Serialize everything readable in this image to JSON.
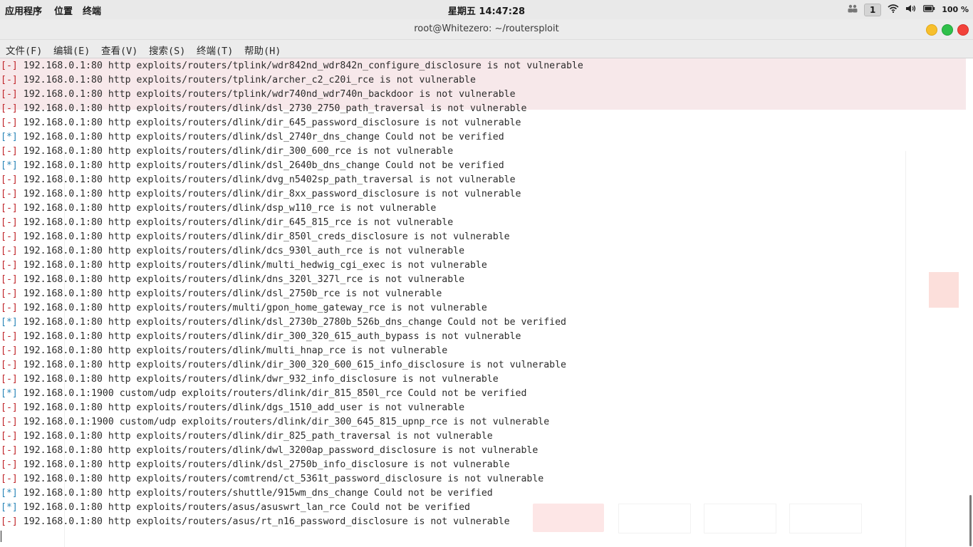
{
  "topbar": {
    "menus": [
      "应用程序",
      "位置",
      "终端"
    ],
    "clock": "星期五 14:47:28",
    "workspace": "1",
    "battery_percent": "100 %",
    "icons": [
      "people-icon",
      "wifi-icon",
      "volume-icon",
      "battery-icon"
    ]
  },
  "window": {
    "title": "root@Whitezero: ~/routersploit",
    "controls": [
      "minimize",
      "maximize",
      "close"
    ],
    "control_colors": {
      "minimize": "#f7bf2c",
      "maximize": "#2fc04a",
      "close": "#f2423a"
    }
  },
  "menubar": [
    "文件(F)",
    "编辑(E)",
    "查看(V)",
    "搜索(S)",
    "终端(T)",
    "帮助(H)"
  ],
  "colors": {
    "minus_prefix": "#c0262b",
    "star_prefix": "#2a86b8",
    "text": "#2b2b2b"
  },
  "terminal_lines": [
    {
      "prefix": "[-]",
      "text": " 192.168.0.1:80 http exploits/routers/tplink/wdr842nd_wdr842n_configure_disclosure is not vulnerable"
    },
    {
      "prefix": "[-]",
      "text": " 192.168.0.1:80 http exploits/routers/tplink/archer_c2_c20i_rce is not vulnerable"
    },
    {
      "prefix": "[-]",
      "text": " 192.168.0.1:80 http exploits/routers/tplink/wdr740nd_wdr740n_backdoor is not vulnerable"
    },
    {
      "prefix": "[-]",
      "text": " 192.168.0.1:80 http exploits/routers/dlink/dsl_2730_2750_path_traversal is not vulnerable"
    },
    {
      "prefix": "[-]",
      "text": " 192.168.0.1:80 http exploits/routers/dlink/dir_645_password_disclosure is not vulnerable"
    },
    {
      "prefix": "[*]",
      "text": " 192.168.0.1:80 http exploits/routers/dlink/dsl_2740r_dns_change Could not be verified"
    },
    {
      "prefix": "[-]",
      "text": " 192.168.0.1:80 http exploits/routers/dlink/dir_300_600_rce is not vulnerable"
    },
    {
      "prefix": "[*]",
      "text": " 192.168.0.1:80 http exploits/routers/dlink/dsl_2640b_dns_change Could not be verified"
    },
    {
      "prefix": "[-]",
      "text": " 192.168.0.1:80 http exploits/routers/dlink/dvg_n5402sp_path_traversal is not vulnerable"
    },
    {
      "prefix": "[-]",
      "text": " 192.168.0.1:80 http exploits/routers/dlink/dir_8xx_password_disclosure is not vulnerable"
    },
    {
      "prefix": "[-]",
      "text": " 192.168.0.1:80 http exploits/routers/dlink/dsp_w110_rce is not vulnerable"
    },
    {
      "prefix": "[-]",
      "text": " 192.168.0.1:80 http exploits/routers/dlink/dir_645_815_rce is not vulnerable"
    },
    {
      "prefix": "[-]",
      "text": " 192.168.0.1:80 http exploits/routers/dlink/dir_850l_creds_disclosure is not vulnerable"
    },
    {
      "prefix": "[-]",
      "text": " 192.168.0.1:80 http exploits/routers/dlink/dcs_930l_auth_rce is not vulnerable"
    },
    {
      "prefix": "[-]",
      "text": " 192.168.0.1:80 http exploits/routers/dlink/multi_hedwig_cgi_exec is not vulnerable"
    },
    {
      "prefix": "[-]",
      "text": " 192.168.0.1:80 http exploits/routers/dlink/dns_320l_327l_rce is not vulnerable"
    },
    {
      "prefix": "[-]",
      "text": " 192.168.0.1:80 http exploits/routers/dlink/dsl_2750b_rce is not vulnerable"
    },
    {
      "prefix": "[-]",
      "text": " 192.168.0.1:80 http exploits/routers/multi/gpon_home_gateway_rce is not vulnerable"
    },
    {
      "prefix": "[*]",
      "text": " 192.168.0.1:80 http exploits/routers/dlink/dsl_2730b_2780b_526b_dns_change Could not be verified"
    },
    {
      "prefix": "[-]",
      "text": " 192.168.0.1:80 http exploits/routers/dlink/dir_300_320_615_auth_bypass is not vulnerable"
    },
    {
      "prefix": "[-]",
      "text": " 192.168.0.1:80 http exploits/routers/dlink/multi_hnap_rce is not vulnerable"
    },
    {
      "prefix": "[-]",
      "text": " 192.168.0.1:80 http exploits/routers/dlink/dir_300_320_600_615_info_disclosure is not vulnerable"
    },
    {
      "prefix": "[-]",
      "text": " 192.168.0.1:80 http exploits/routers/dlink/dwr_932_info_disclosure is not vulnerable"
    },
    {
      "prefix": "[*]",
      "text": " 192.168.0.1:1900 custom/udp exploits/routers/dlink/dir_815_850l_rce Could not be verified"
    },
    {
      "prefix": "[-]",
      "text": " 192.168.0.1:80 http exploits/routers/dlink/dgs_1510_add_user is not vulnerable"
    },
    {
      "prefix": "[-]",
      "text": " 192.168.0.1:1900 custom/udp exploits/routers/dlink/dir_300_645_815_upnp_rce is not vulnerable"
    },
    {
      "prefix": "[-]",
      "text": " 192.168.0.1:80 http exploits/routers/dlink/dir_825_path_traversal is not vulnerable"
    },
    {
      "prefix": "[-]",
      "text": " 192.168.0.1:80 http exploits/routers/dlink/dwl_3200ap_password_disclosure is not vulnerable"
    },
    {
      "prefix": "[-]",
      "text": " 192.168.0.1:80 http exploits/routers/dlink/dsl_2750b_info_disclosure is not vulnerable"
    },
    {
      "prefix": "[-]",
      "text": " 192.168.0.1:80 http exploits/routers/comtrend/ct_5361t_password_disclosure is not vulnerable"
    },
    {
      "prefix": "[*]",
      "text": " 192.168.0.1:80 http exploits/routers/shuttle/915wm_dns_change Could not be verified"
    },
    {
      "prefix": "[*]",
      "text": " 192.168.0.1:80 http exploits/routers/asus/asuswrt_lan_rce Could not be verified"
    },
    {
      "prefix": "[-]",
      "text": " 192.168.0.1:80 http exploits/routers/asus/rt_n16_password_disclosure is not vulnerable"
    }
  ]
}
